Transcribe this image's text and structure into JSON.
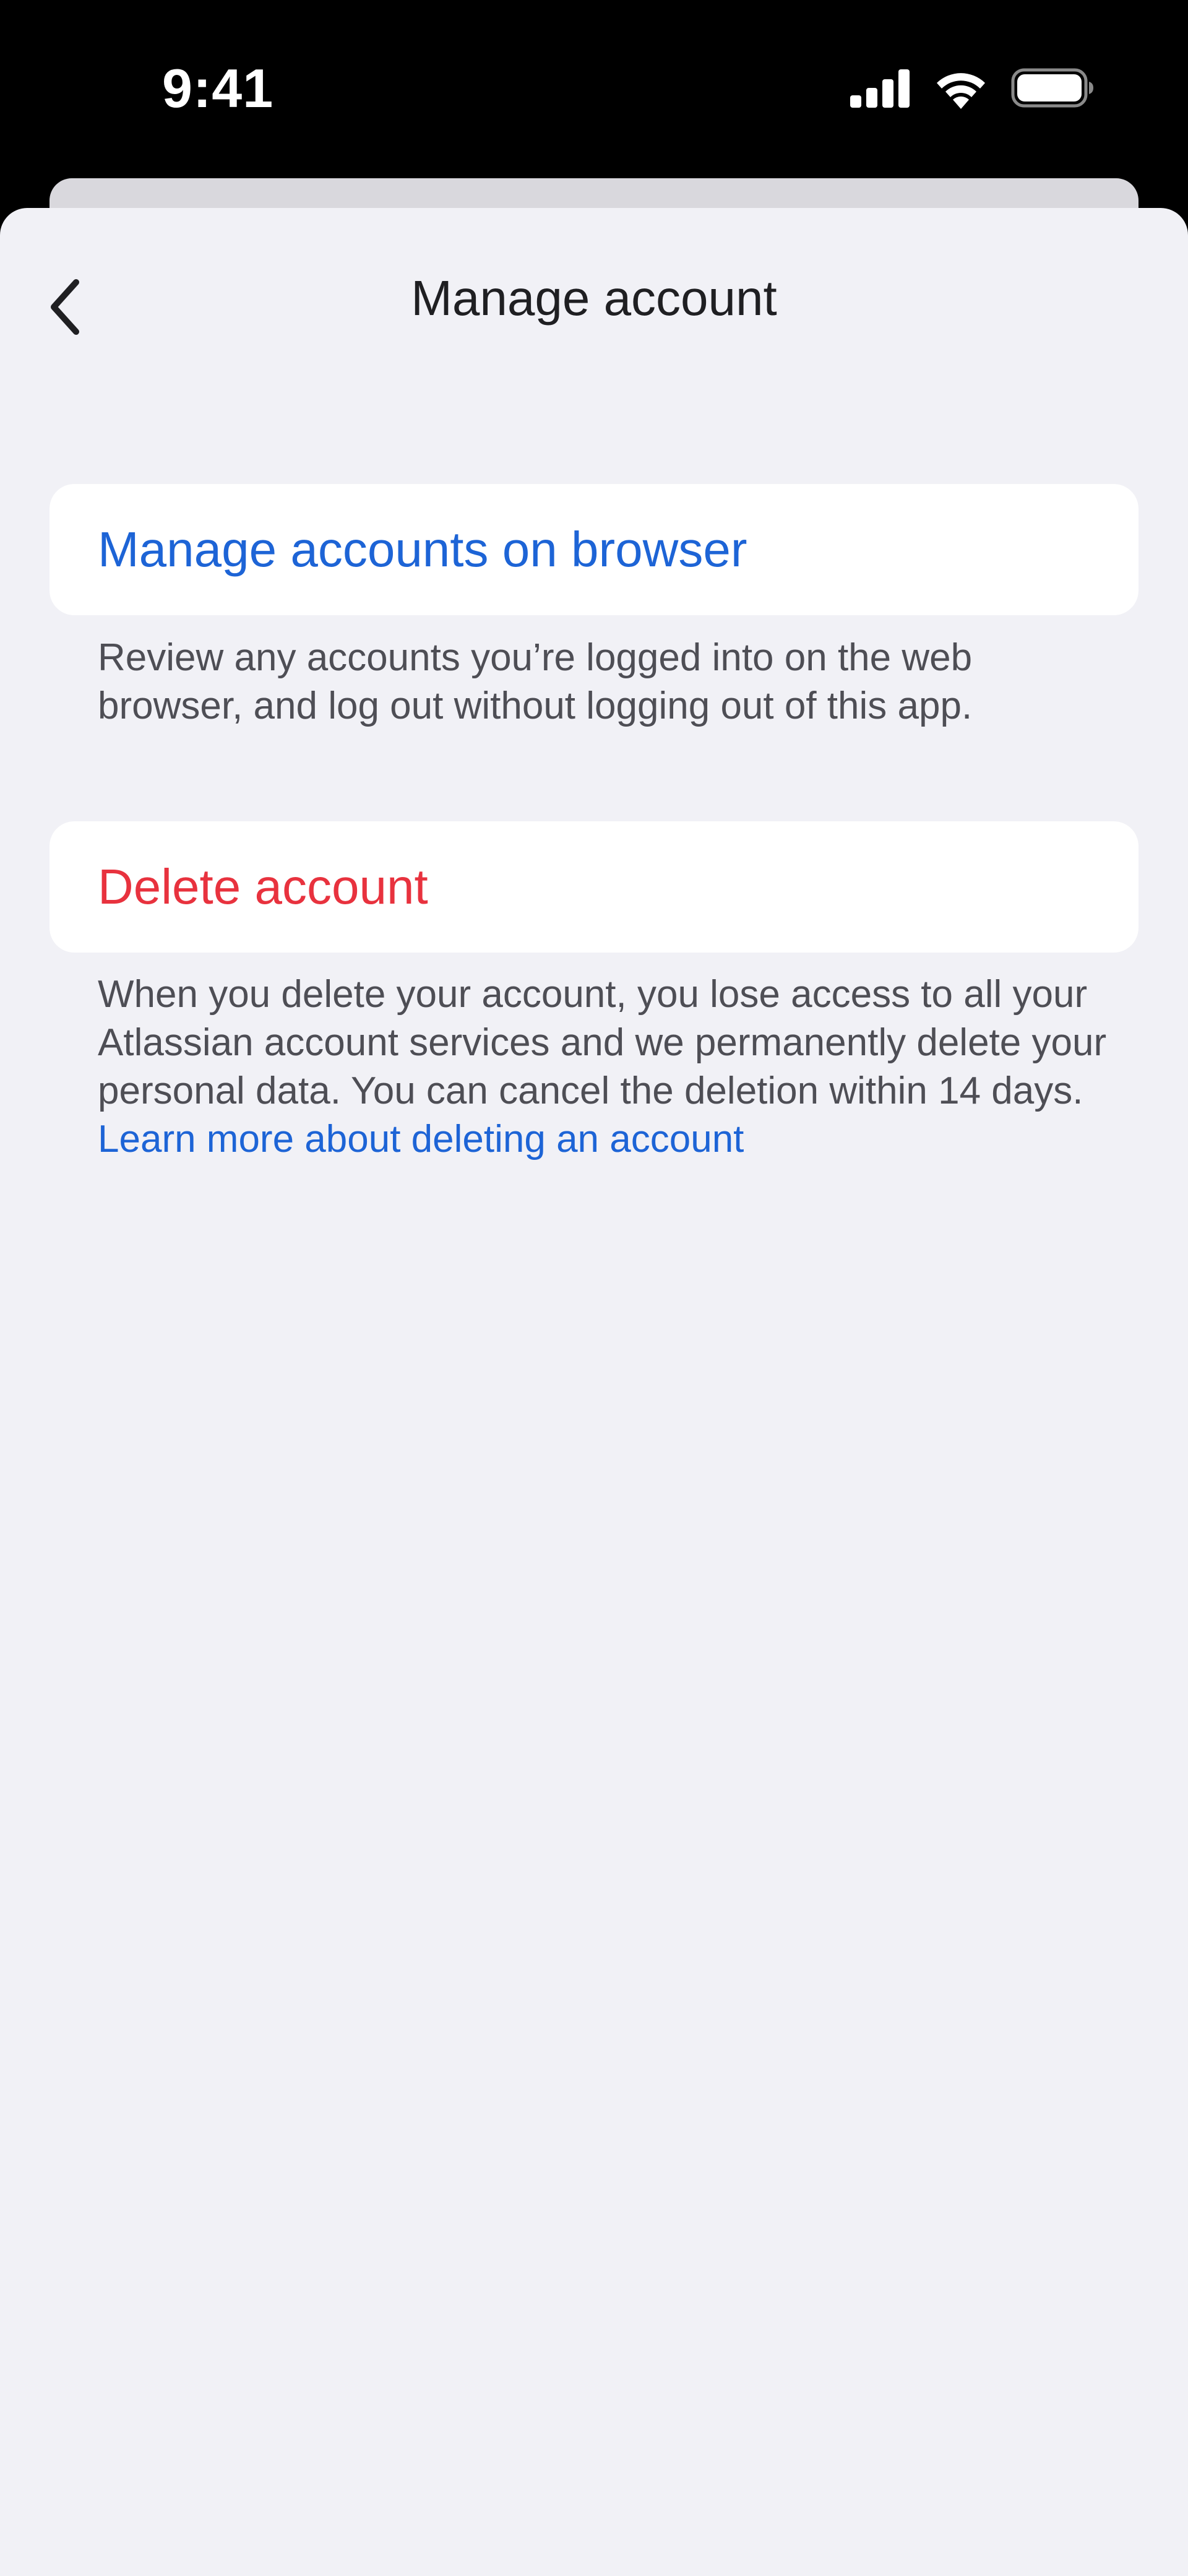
{
  "status_bar": {
    "time": "9:41",
    "icons": [
      "cellular-signal-icon",
      "wifi-icon",
      "battery-icon"
    ]
  },
  "nav": {
    "title": "Manage account",
    "back_icon": "chevron-left-icon"
  },
  "options": {
    "manage_browser": {
      "label": "Manage accounts on browser",
      "description": "Review any accounts you’re logged into on the web browser, and log out without logging out of this app."
    },
    "delete_account": {
      "label": "Delete account",
      "description": "When you delete your account, you lose access to all your Atlassian account services and we permanently delete your personal data. You can cancel the deletion within 14 days.",
      "link": "Learn more about deleting an account"
    }
  },
  "colors": {
    "link_blue": "#1d64d6",
    "danger_red": "#e8323e",
    "background": "#f1f1f6",
    "card": "#ffffff",
    "secondary_text": "#4e4e55"
  }
}
